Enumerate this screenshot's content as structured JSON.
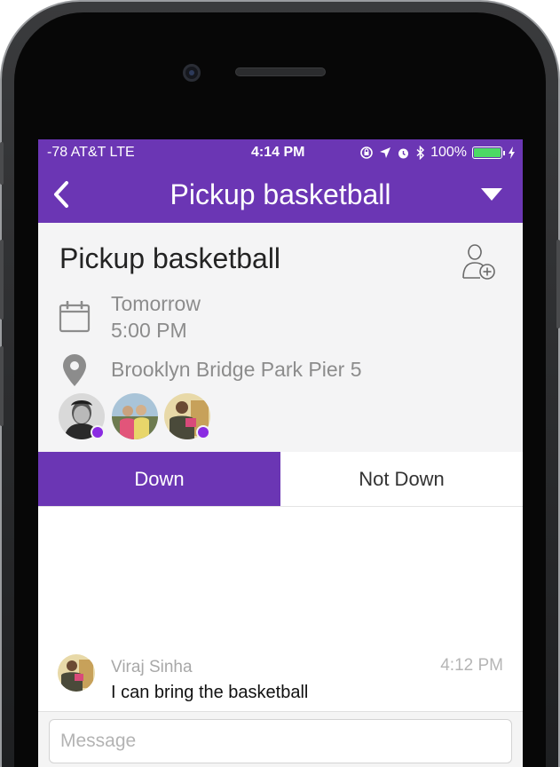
{
  "status_bar": {
    "carrier": "-78 AT&T  LTE",
    "time": "4:14 PM",
    "battery": "100%"
  },
  "nav": {
    "title": "Pickup basketball"
  },
  "event": {
    "title": "Pickup basketball",
    "date": "Tomorrow",
    "time": "5:00 PM",
    "location": "Brooklyn Bridge Park Pier 5",
    "attendee_count": 3
  },
  "tabs": {
    "down": "Down",
    "not_down": "Not Down",
    "selected": "Down"
  },
  "messages": [
    {
      "sender": "Viraj Sinha",
      "time": "4:12 PM",
      "text": "I can bring the basketball"
    }
  ],
  "composer": {
    "placeholder": "Message"
  },
  "colors": {
    "brand": "#6b36b4",
    "online": "#8a2be2",
    "battery": "#4cd964"
  }
}
